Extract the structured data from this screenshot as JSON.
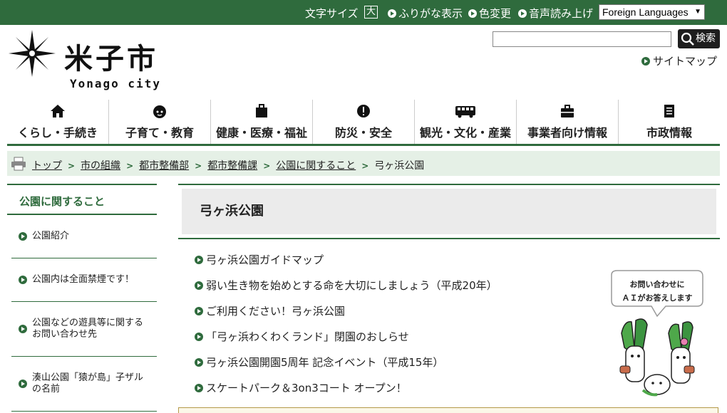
{
  "topbar": {
    "font_size_label": "文字サイズ",
    "font_size_button": "大",
    "furigana": "ふりがな表示",
    "color_change": "色変更",
    "read_aloud": "音声読み上げ",
    "language_select": "Foreign Languages"
  },
  "logo": {
    "name": "米子市",
    "sub": "Yonago city"
  },
  "search": {
    "value": "",
    "button": "検索"
  },
  "sitemap": "サイトマップ",
  "nav": [
    {
      "label": "くらし・手続き",
      "icon": "house-icon"
    },
    {
      "label": "子育て・教育",
      "icon": "child-icon"
    },
    {
      "label": "健康・医療・福祉",
      "icon": "medical-bag-icon"
    },
    {
      "label": "防災・安全",
      "icon": "alert-icon"
    },
    {
      "label": "観光・文化・産業",
      "icon": "bus-icon"
    },
    {
      "label": "事業者向け情報",
      "icon": "briefcase-icon"
    },
    {
      "label": "市政情報",
      "icon": "document-icon"
    }
  ],
  "breadcrumb": [
    "トップ",
    "市の組織",
    "都市整備部",
    "都市整備課",
    "公園に関すること",
    "弓ヶ浜公園"
  ],
  "sidebar": {
    "heading": "公園に関すること",
    "items": [
      "公園紹介",
      "公園内は全面禁煙です！",
      "公園などの遊具等に関するお問い合わせ先",
      "湊山公園「猿が島」子ザルの名前"
    ]
  },
  "page_title": "弓ヶ浜公園",
  "links": [
    "弓ヶ浜公園ガイドマップ",
    "弱い生き物を始めとする命を大切にしましょう（平成20年）",
    "ご利用ください！弓ヶ浜公園",
    "「弓ヶ浜わくわくランド」閉園のおしらせ",
    "弓ヶ浜公園開園5周年 記念イベント（平成15年）",
    "スケートパーク＆3on3コート オープン！"
  ],
  "mascot_bubble": [
    "お問い合わせに",
    "ＡＩがお答えします"
  ],
  "colors": {
    "brand_green": "#2f6b3d",
    "breadcrumb_bg": "#e5f0e6",
    "title_bg": "#ebebeb"
  }
}
